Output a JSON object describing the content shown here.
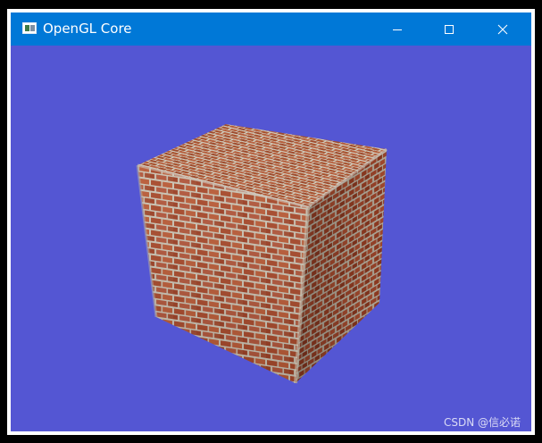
{
  "window": {
    "title": "OpenGL Core",
    "icon": "app-window-icon",
    "controls": {
      "minimize": "minimize-icon",
      "maximize": "maximize-icon",
      "close": "close-icon"
    }
  },
  "viewport": {
    "background": "#5456d3",
    "object": "textured-cube",
    "texture": "brick-wall"
  },
  "watermark": "CSDN @信必诺",
  "colors": {
    "titlebar": "#0078d7",
    "clear_color": "#5456d3",
    "brick": "#a24a2a",
    "mortar": "#c9c2b2"
  }
}
